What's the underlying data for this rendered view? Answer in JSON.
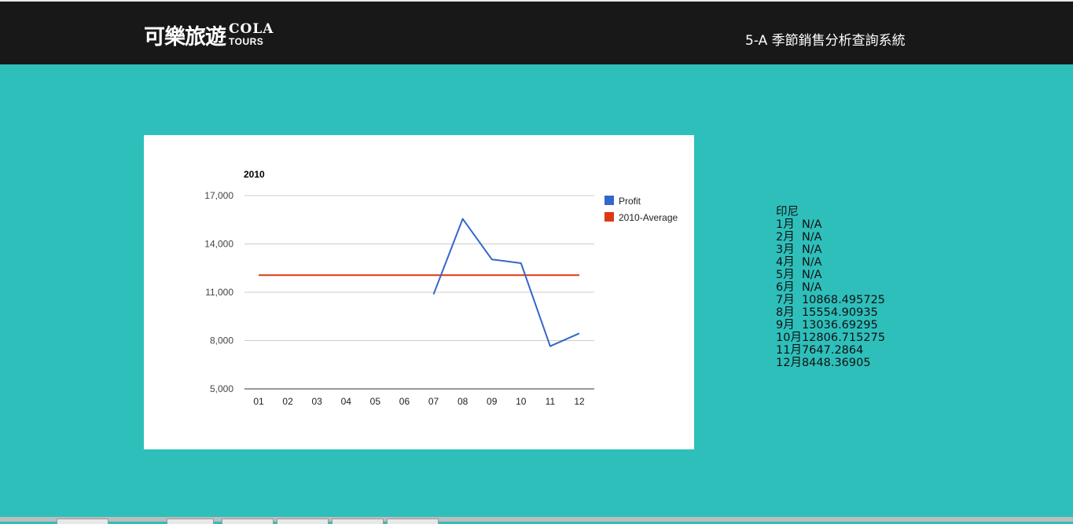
{
  "header": {
    "logo_cn": "可樂旅遊",
    "logo_en_top": "COLA",
    "logo_en_bottom": "TOURS",
    "system_title": "5-A 季節銷售分析查詢系統"
  },
  "chart_data": {
    "type": "line",
    "title": "2010",
    "categories": [
      "01",
      "02",
      "03",
      "04",
      "05",
      "06",
      "07",
      "08",
      "09",
      "10",
      "11",
      "12"
    ],
    "ylim": [
      5000,
      17000
    ],
    "yticks": [
      5000,
      8000,
      11000,
      14000,
      17000
    ],
    "ytick_labels": [
      "5,000",
      "8,000",
      "11,000",
      "14,000",
      "17,000"
    ],
    "grid": true,
    "legend_position": "right",
    "series": [
      {
        "name": "Profit",
        "color": "#3366cc",
        "values": [
          null,
          null,
          null,
          null,
          null,
          null,
          10868.495725,
          15554.90935,
          13036.69295,
          12806.715275,
          7647.2864,
          8448.36905
        ]
      },
      {
        "name": "2010-Average",
        "color": "#dc3912",
        "values": [
          12060,
          12060,
          12060,
          12060,
          12060,
          12060,
          12060,
          12060,
          12060,
          12060,
          12060,
          12060
        ]
      }
    ]
  },
  "info": {
    "country": "印尼",
    "rows": [
      "1月  N/A",
      "2月  N/A",
      "3月  N/A",
      "4月  N/A",
      "5月  N/A",
      "6月  N/A",
      "7月  10868.495725",
      "8月  15554.90935",
      "9月  13036.69295",
      "10月12806.715275",
      "11月7647.2864",
      "12月8448.36905"
    ]
  }
}
